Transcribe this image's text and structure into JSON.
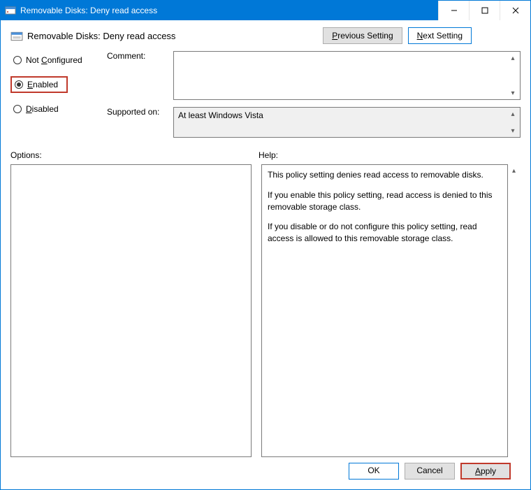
{
  "window": {
    "title": "Removable Disks: Deny read access"
  },
  "header": {
    "policy_title": "Removable Disks: Deny read access",
    "previous_setting": "Previous Setting",
    "next_setting": "Next Setting"
  },
  "state_options": {
    "not_configured": "Not Configured",
    "enabled": "Enabled",
    "disabled": "Disabled",
    "selected": "enabled"
  },
  "fields": {
    "comment_label": "Comment:",
    "comment_value": "",
    "supported_label": "Supported on:",
    "supported_value": "At least Windows Vista"
  },
  "panels": {
    "options_label": "Options:",
    "help_label": "Help:",
    "help_p1": "This policy setting denies read access to removable disks.",
    "help_p2": "If you enable this policy setting, read access is denied to this removable storage class.",
    "help_p3": "If you disable or do not configure this policy setting, read access is allowed to this removable storage class."
  },
  "footer": {
    "ok": "OK",
    "cancel": "Cancel",
    "apply": "Apply"
  }
}
